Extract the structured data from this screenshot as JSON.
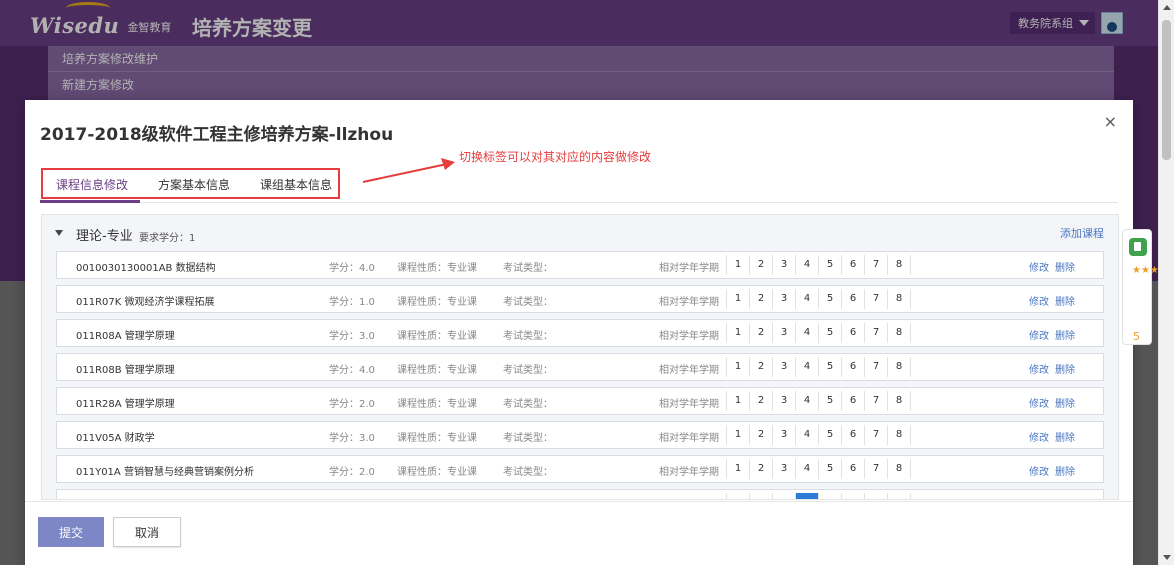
{
  "app": {
    "logo_word": "Wisedu",
    "logo_cn": "金智教育",
    "title": "培养方案变更",
    "user_select": "教务院系组"
  },
  "subnav": {
    "items": [
      "培养方案修改维护",
      "新建方案修改"
    ]
  },
  "modal": {
    "title": "2017-2018级软件工程主修培养方案-llzhou",
    "close": "×",
    "annotation": "切换标签可以对其对应的内容做修改",
    "tabs": [
      "课程信息修改",
      "方案基本信息",
      "课组基本信息"
    ],
    "group": {
      "title": "理论-专业",
      "requirement": "要求学分：1",
      "add_course": "添加课程"
    },
    "courses": [
      {
        "code": "0010030130001AB  数据结构",
        "credit": "学分：4.0",
        "nature": "课程性质：专业课",
        "exam": "考试类型：",
        "term_label": "相对学年学期"
      },
      {
        "code": "011R07K  微观经济学课程拓展",
        "credit": "学分：1.0",
        "nature": "课程性质：专业课",
        "exam": "考试类型：",
        "term_label": "相对学年学期"
      },
      {
        "code": "011R08A  管理学原理",
        "credit": "学分：3.0",
        "nature": "课程性质：专业课",
        "exam": "考试类型：",
        "term_label": "相对学年学期"
      },
      {
        "code": "011R08B  管理学原理",
        "credit": "学分：4.0",
        "nature": "课程性质：专业课",
        "exam": "考试类型：",
        "term_label": "相对学年学期"
      },
      {
        "code": "011R28A  管理学原理",
        "credit": "学分：2.0",
        "nature": "课程性质：专业课",
        "exam": "考试类型：",
        "term_label": "相对学年学期"
      },
      {
        "code": "011V05A  财政学",
        "credit": "学分：3.0",
        "nature": "课程性质：专业课",
        "exam": "考试类型：",
        "term_label": "相对学年学期"
      },
      {
        "code": "011Y01A  营销智慧与经典营销案例分析",
        "credit": "学分：2.0",
        "nature": "课程性质：专业课",
        "exam": "考试类型：",
        "term_label": "相对学年学期"
      }
    ],
    "terms": [
      "1",
      "2",
      "3",
      "4",
      "5",
      "6",
      "7",
      "8"
    ],
    "edit_label": "修改",
    "delete_label": "删除",
    "submit_label": "提交",
    "cancel_label": "取消"
  },
  "rating": {
    "stars": "★★★★★",
    "value": "5"
  },
  "colors": {
    "brand_purple": "#6a3f87",
    "annotation_red": "#e63c3c",
    "link_blue": "#4a76c2",
    "submit_button": "#7d87c6",
    "rating_orange": "#f2a024"
  }
}
